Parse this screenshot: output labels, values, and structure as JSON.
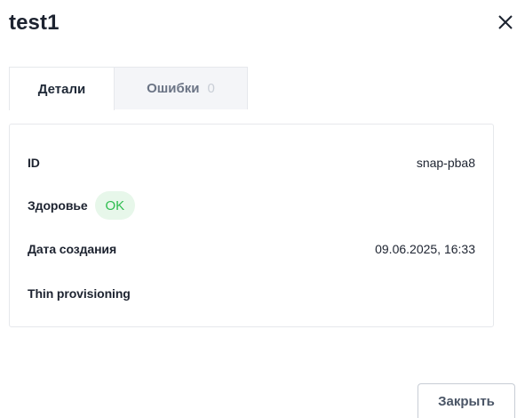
{
  "dialog": {
    "title": "test1",
    "close_icon": "close-icon"
  },
  "tabs": [
    {
      "label": "Детали",
      "active": true
    },
    {
      "label": "Ошибки",
      "count": "0",
      "active": false
    }
  ],
  "details": {
    "id_label": "ID",
    "id_value": "snap-pba8",
    "health_label": "Здоровье",
    "health_value": "OK",
    "created_label": "Дата создания",
    "created_value": "09.06.2025, 16:33",
    "thin_label": "Thin provisioning",
    "thin_value": ""
  },
  "footer": {
    "close_label": "Закрыть"
  },
  "colors": {
    "badge_ok_bg": "#e7f7ea",
    "badge_ok_text": "#2ebd4f",
    "tab_inactive_bg": "#f4f5f8"
  }
}
